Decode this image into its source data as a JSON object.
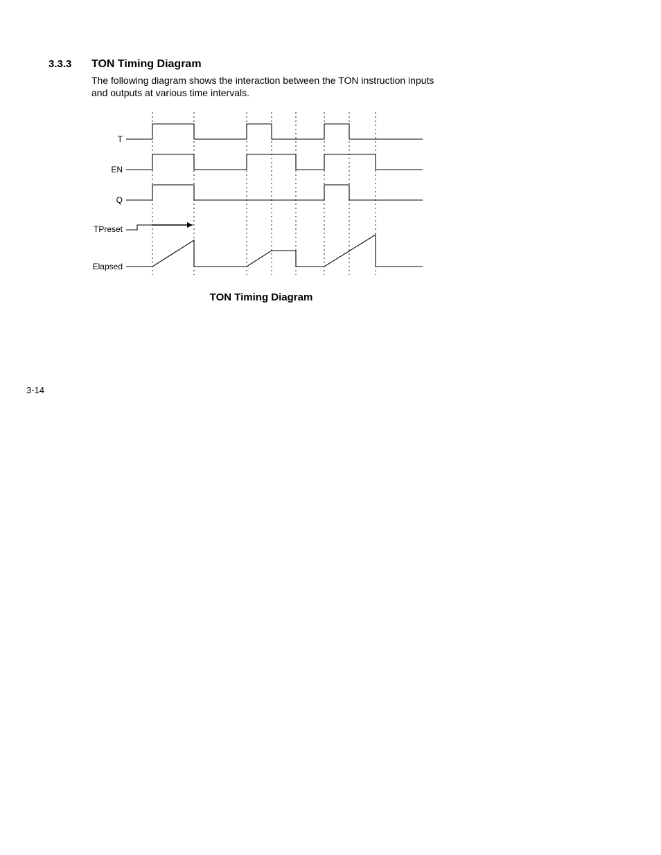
{
  "section": {
    "number": "3.3.3",
    "title": "TON Timing Diagram",
    "body": "The following diagram shows the interaction between the TON instruction inputs and outputs at various time intervals."
  },
  "diagram": {
    "caption": "TON Timing Diagram",
    "signals": {
      "t": "T",
      "en": "EN",
      "q": "Q",
      "tpreset": "TPreset",
      "elapsed": "Elapsed"
    }
  },
  "page_number": "3-14"
}
